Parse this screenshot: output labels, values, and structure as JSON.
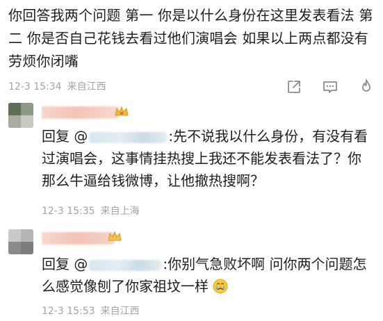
{
  "main_comment": {
    "text": "你回答我两个问题 第一 你是以什么身份在这里发表看法 第二 你是否自己花钱去看过他们演唱会  如果以上两点都没有 劳烦你闭嘴",
    "time": "12-3 15:34",
    "location": "来自江西"
  },
  "actions": {
    "share_icon": "share-icon",
    "comment_icon": "comment-icon",
    "like_icon": "like-flame-icon"
  },
  "replies": [
    {
      "prefix": "回复",
      "at": "@",
      "after_mention": ":先不说我以什么身份，有没有看过演唱会，这事情挂热搜上我还不能发表看法了？你那么牛逼给钱微博，让他撤热搜啊？",
      "time": "12-3 15:35",
      "location": "来自上海"
    },
    {
      "prefix": "回复",
      "at": "@",
      "after_mention": ":你别气急败坏啊 问你两个问题怎么感觉像刨了你家祖坟一样",
      "emoji": "crying-face-emoji",
      "time": "12-3 15:53",
      "location": "来自江西"
    }
  ],
  "colors": {
    "meta_text": "#a3a3a3",
    "body_text": "#1d1d1d",
    "nickname_blur": "#f3c7bd"
  }
}
